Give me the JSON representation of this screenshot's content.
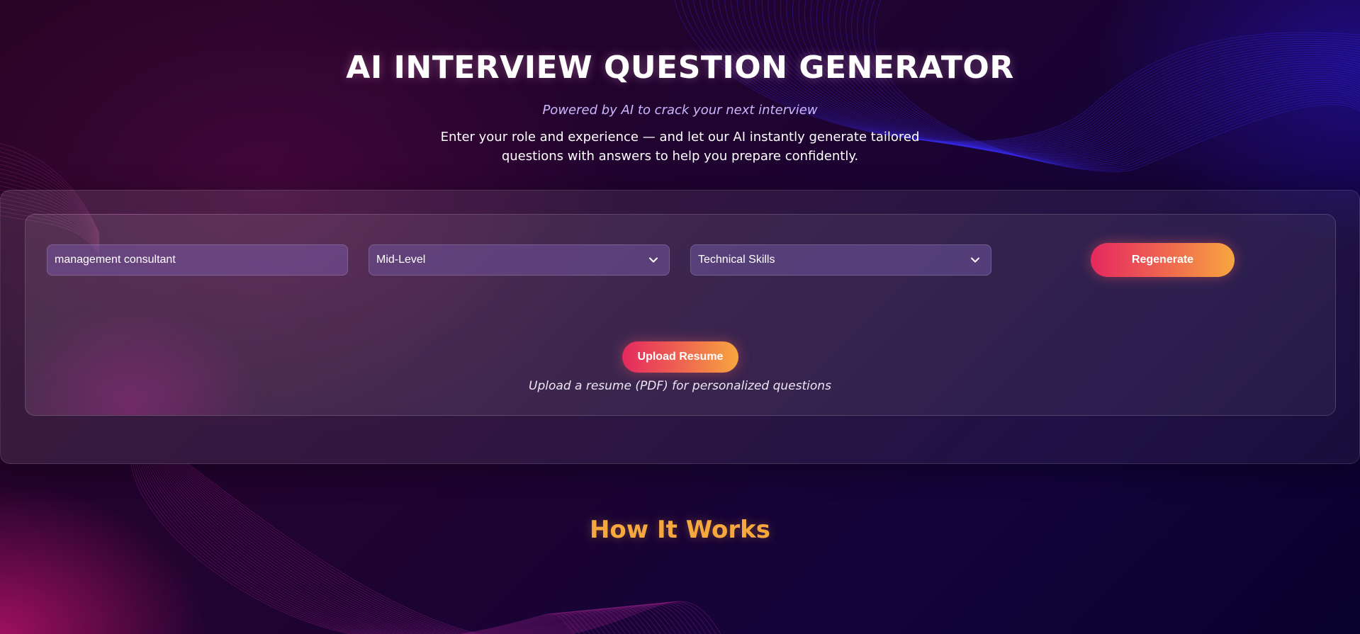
{
  "header": {
    "title": "AI INTERVIEW QUESTION GENERATOR",
    "tagline": "Powered by AI to crack your next interview",
    "description": "Enter your role and experience — and let our AI instantly generate tailored questions with answers to help you prepare confidently."
  },
  "form": {
    "role_value": "management consultant",
    "level_selected": "Mid-Level",
    "category_selected": "Technical Skills",
    "regenerate_label": "Regenerate",
    "upload_label": "Upload Resume",
    "upload_hint": "Upload a resume (PDF) for personalized questions",
    "dropdown_icon": "chevron-down-icon"
  },
  "how_it_works": {
    "heading": "How It Works"
  },
  "colors": {
    "accent_start": "#e5285f",
    "accent_end": "#f7a63f",
    "heading_orange": "#f6a83e",
    "tagline_lavender": "#c9b8ff",
    "background_dark": "#1f0330"
  }
}
